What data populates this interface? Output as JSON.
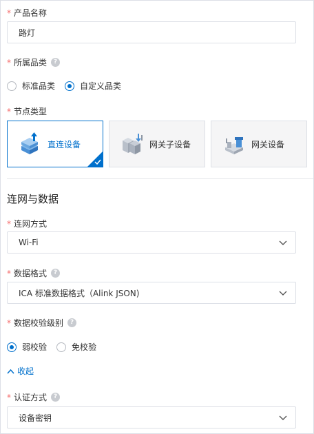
{
  "product_name": {
    "required_mark": "*",
    "label": "产品名称",
    "value": "路灯"
  },
  "category": {
    "required_mark": "*",
    "label": "所属品类",
    "help": "?",
    "options": [
      {
        "label": "标准品类",
        "checked": false
      },
      {
        "label": "自定义品类",
        "checked": true
      }
    ]
  },
  "node_type": {
    "required_mark": "*",
    "label": "节点类型",
    "cards": [
      {
        "label": "直连设备",
        "selected": true,
        "icon": "direct-device-icon"
      },
      {
        "label": "网关子设备",
        "selected": false,
        "icon": "gateway-subdevice-icon"
      },
      {
        "label": "网关设备",
        "selected": false,
        "icon": "gateway-device-icon"
      }
    ]
  },
  "network_section": {
    "title": "连网与数据"
  },
  "network_method": {
    "required_mark": "*",
    "label": "连网方式",
    "value": "Wi-Fi"
  },
  "data_format": {
    "required_mark": "*",
    "label": "数据格式",
    "help": "?",
    "value": "ICA 标准数据格式（Alink JSON)"
  },
  "check_level": {
    "required_mark": "*",
    "label": "数据校验级别",
    "help": "?",
    "options": [
      {
        "label": "弱校验",
        "checked": true
      },
      {
        "label": "免校验",
        "checked": false
      }
    ]
  },
  "collapse": {
    "label": "收起"
  },
  "auth_method": {
    "required_mark": "*",
    "label": "认证方式",
    "help": "?",
    "value": "设备密钥"
  },
  "colors": {
    "accent": "#0070cc",
    "required": "#f56c6c",
    "border": "#dcdfe6"
  }
}
